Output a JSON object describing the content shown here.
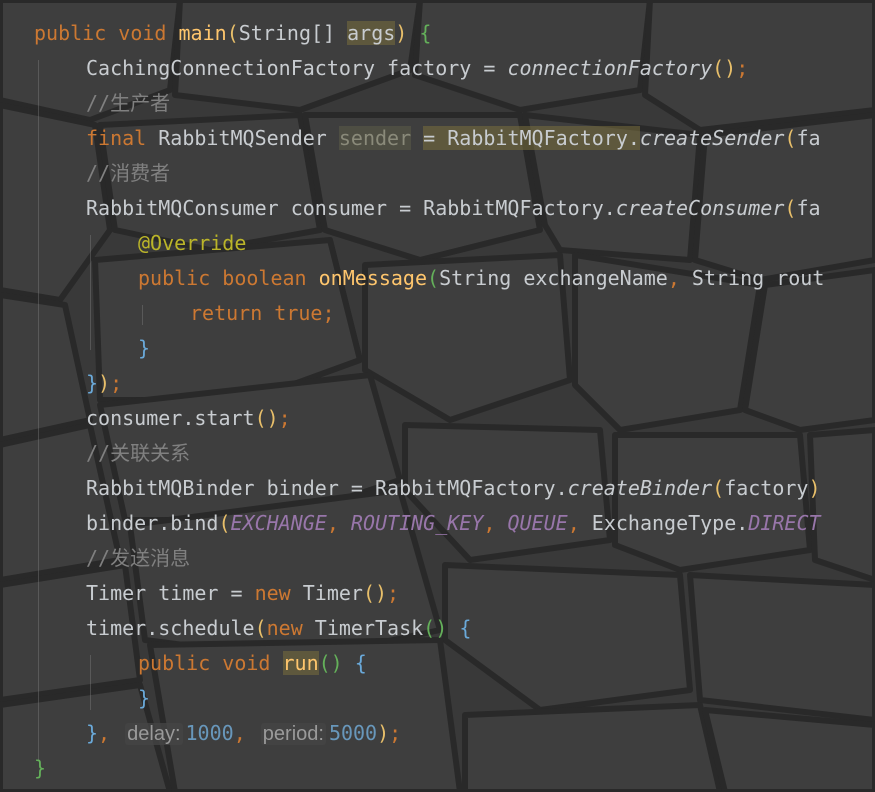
{
  "editor": {
    "lines": [
      {
        "indent": 0,
        "tokens": [
          {
            "t": "public",
            "c": "kw"
          },
          {
            "t": " "
          },
          {
            "t": "void",
            "c": "kw"
          },
          {
            "t": " "
          },
          {
            "t": "main",
            "c": "fn"
          },
          {
            "t": "(",
            "c": "b1"
          },
          {
            "t": "String[]",
            "c": "ty"
          },
          {
            "t": " "
          },
          {
            "t": "args",
            "c": "hl"
          },
          {
            "t": ")",
            "c": "b1"
          },
          {
            "t": " "
          },
          {
            "t": "{",
            "c": "b3"
          }
        ]
      },
      {
        "indent": 1,
        "tokens": [
          {
            "t": "CachingConnectionFactory factory = "
          },
          {
            "t": "connectionFactory",
            "c": "it"
          },
          {
            "t": "()",
            "c": "b1"
          },
          {
            "t": ";",
            "c": "kw"
          }
        ]
      },
      {
        "indent": 1,
        "tokens": [
          {
            "t": "//生产者",
            "c": "cm"
          }
        ]
      },
      {
        "indent": 1,
        "tokens": [
          {
            "t": "final",
            "c": "kw"
          },
          {
            "t": " RabbitMQSender "
          },
          {
            "t": "sender",
            "c": "hl2"
          },
          {
            "t": " "
          },
          {
            "t": "= RabbitMQFactory.",
            "c": "hl"
          },
          {
            "t": "createSender",
            "c": "it"
          },
          {
            "t": "(",
            "c": "b1"
          },
          {
            "t": "fa"
          }
        ]
      },
      {
        "indent": 1,
        "tokens": [
          {
            "t": "//消费者",
            "c": "cm"
          }
        ]
      },
      {
        "indent": 1,
        "tokens": [
          {
            "t": "RabbitMQConsumer consumer = RabbitMQFactory."
          },
          {
            "t": "createConsumer",
            "c": "it"
          },
          {
            "t": "(",
            "c": "b1"
          },
          {
            "t": "fa"
          }
        ]
      },
      {
        "indent": 2,
        "tokens": [
          {
            "t": "@Override",
            "c": "ann"
          }
        ]
      },
      {
        "indent": 2,
        "tokens": [
          {
            "t": "public",
            "c": "kw"
          },
          {
            "t": " "
          },
          {
            "t": "boolean",
            "c": "kw"
          },
          {
            "t": " "
          },
          {
            "t": "onMessage",
            "c": "fn"
          },
          {
            "t": "(",
            "c": "b3"
          },
          {
            "t": "String exchangeName"
          },
          {
            "t": ",",
            "c": "kw"
          },
          {
            "t": " String rout"
          }
        ]
      },
      {
        "indent": 3,
        "tokens": [
          {
            "t": "return",
            "c": "kw"
          },
          {
            "t": " "
          },
          {
            "t": "true",
            "c": "kw"
          },
          {
            "t": ";",
            "c": "kw"
          }
        ]
      },
      {
        "indent": 2,
        "tokens": [
          {
            "t": "}",
            "c": "b2"
          }
        ]
      },
      {
        "indent": 1,
        "tokens": [
          {
            "t": "}",
            "c": "b2"
          },
          {
            "t": ")",
            "c": "b1"
          },
          {
            "t": ";",
            "c": "kw"
          }
        ]
      },
      {
        "indent": 1,
        "tokens": [
          {
            "t": "consumer.start"
          },
          {
            "t": "()",
            "c": "b1"
          },
          {
            "t": ";",
            "c": "kw"
          }
        ]
      },
      {
        "indent": 1,
        "tokens": [
          {
            "t": "//关联关系",
            "c": "cm"
          }
        ]
      },
      {
        "indent": 1,
        "tokens": [
          {
            "t": "RabbitMQBinder binder = RabbitMQFactory."
          },
          {
            "t": "createBinder",
            "c": "it"
          },
          {
            "t": "(",
            "c": "b1"
          },
          {
            "t": "factory"
          },
          {
            "t": ")",
            "c": "b1"
          }
        ]
      },
      {
        "indent": 1,
        "tokens": [
          {
            "t": "binder.bind"
          },
          {
            "t": "(",
            "c": "b1"
          },
          {
            "t": "EXCHANGE",
            "c": "cst"
          },
          {
            "t": ",",
            "c": "kw"
          },
          {
            "t": " "
          },
          {
            "t": "ROUTING_KEY",
            "c": "cst"
          },
          {
            "t": ",",
            "c": "kw"
          },
          {
            "t": " "
          },
          {
            "t": "QUEUE",
            "c": "cst"
          },
          {
            "t": ",",
            "c": "kw"
          },
          {
            "t": " ExchangeType."
          },
          {
            "t": "DIRECT",
            "c": "cst"
          }
        ]
      },
      {
        "indent": 1,
        "tokens": [
          {
            "t": "//发送消息",
            "c": "cm"
          }
        ]
      },
      {
        "indent": 1,
        "tokens": [
          {
            "t": "Timer timer = "
          },
          {
            "t": "new",
            "c": "kw"
          },
          {
            "t": " Timer"
          },
          {
            "t": "()",
            "c": "b1"
          },
          {
            "t": ";",
            "c": "kw"
          }
        ]
      },
      {
        "indent": 1,
        "tokens": [
          {
            "t": "timer.schedule"
          },
          {
            "t": "(",
            "c": "b1"
          },
          {
            "t": "new",
            "c": "kw"
          },
          {
            "t": " TimerTask"
          },
          {
            "t": "()",
            "c": "b3"
          },
          {
            "t": " "
          },
          {
            "t": "{",
            "c": "b2"
          }
        ]
      },
      {
        "indent": 2,
        "tokens": [
          {
            "t": "public",
            "c": "kw"
          },
          {
            "t": " "
          },
          {
            "t": "void",
            "c": "kw"
          },
          {
            "t": " "
          },
          {
            "t": "run",
            "c": "fn hl"
          },
          {
            "t": "()",
            "c": "b3"
          },
          {
            "t": " "
          },
          {
            "t": "{",
            "c": "b2"
          }
        ]
      },
      {
        "indent": 2,
        "tokens": [
          {
            "t": "}",
            "c": "b2"
          }
        ]
      },
      {
        "indent": 1,
        "tokens": [
          {
            "t": "}",
            "c": "b2"
          },
          {
            "t": ",",
            "c": "kw"
          },
          {
            "t": " "
          },
          {
            "t": "delay:",
            "c": "hint"
          },
          {
            "t": "1000",
            "c": "num"
          },
          {
            "t": ",",
            "c": "kw"
          },
          {
            "t": " "
          },
          {
            "t": "period:",
            "c": "hint"
          },
          {
            "t": "5000",
            "c": "num"
          },
          {
            "t": ")",
            "c": "b1"
          },
          {
            "t": ";",
            "c": "kw"
          }
        ]
      },
      {
        "indent": 0,
        "tokens": [
          {
            "t": "}",
            "c": "b3"
          }
        ]
      }
    ]
  }
}
